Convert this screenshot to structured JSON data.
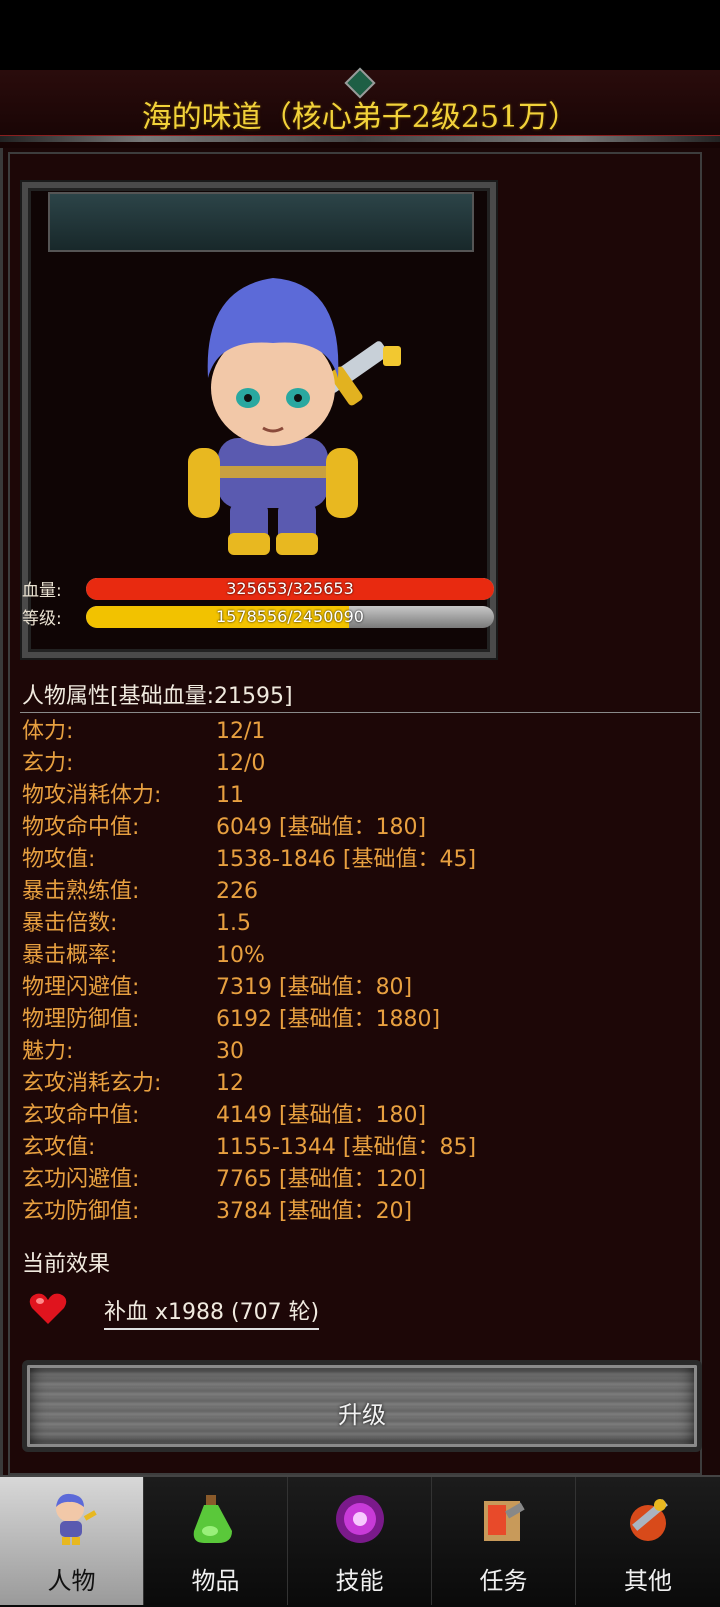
{
  "title": "海的味道（核心弟子2级251万）",
  "bars": {
    "hp": {
      "label": "血量:",
      "text": "325653/325653",
      "fraction": 1.0,
      "color": "#e82a10"
    },
    "level": {
      "label": "等级:",
      "text": "1578556/2450090",
      "fraction": 0.644,
      "color": "#f2c200"
    }
  },
  "attributes": {
    "header": "人物属性[基础血量:21595]",
    "rows": [
      {
        "key": "体力:",
        "value": "12/1"
      },
      {
        "key": "玄力:",
        "value": "12/0"
      },
      {
        "key": "物攻消耗体力:",
        "value": "11"
      },
      {
        "key": "物攻命中值:",
        "value": "6049 [基础值：180]"
      },
      {
        "key": "物攻值:",
        "value": "1538-1846 [基础值：45]"
      },
      {
        "key": "暴击熟练值:",
        "value": "226"
      },
      {
        "key": "暴击倍数:",
        "value": "1.5"
      },
      {
        "key": "暴击概率:",
        "value": "10%"
      },
      {
        "key": "物理闪避值:",
        "value": "7319 [基础值：80]"
      },
      {
        "key": "物理防御值:",
        "value": "6192 [基础值：1880]"
      },
      {
        "key": "魅力:",
        "value": "30"
      },
      {
        "key": "玄攻消耗玄力:",
        "value": "12"
      },
      {
        "key": "玄攻命中值:",
        "value": "4149 [基础值：180]"
      },
      {
        "key": "玄攻值:",
        "value": "1155-1344 [基础值：85]"
      },
      {
        "key": "玄功闪避值:",
        "value": "7765 [基础值：120]"
      },
      {
        "key": "玄功防御值:",
        "value": "3784 [基础值：20]"
      }
    ]
  },
  "effects": {
    "title": "当前效果",
    "items": [
      {
        "icon": "heart-icon",
        "text": "补血 x1988 (707 轮)"
      }
    ]
  },
  "upgrade_button": "升级",
  "tabs": [
    {
      "label": "人物",
      "icon": "character-icon",
      "active": true
    },
    {
      "label": "物品",
      "icon": "potion-icon",
      "active": false
    },
    {
      "label": "技能",
      "icon": "skill-icon",
      "active": false
    },
    {
      "label": "任务",
      "icon": "quest-icon",
      "active": false
    },
    {
      "label": "其他",
      "icon": "other-icon",
      "active": false
    }
  ]
}
